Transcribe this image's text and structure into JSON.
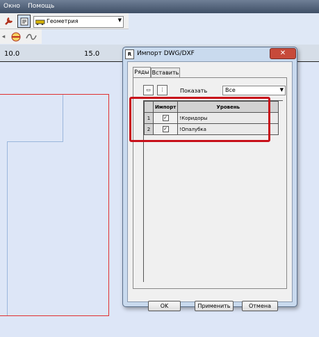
{
  "menu": {
    "items": [
      "Окно",
      "Помощь"
    ]
  },
  "toolbar": {
    "combo_value": "Геометрия"
  },
  "ruler": {
    "labels": [
      "10.0",
      "15.0"
    ]
  },
  "dialog": {
    "title": "Импорт DWG/DXF",
    "title_icon_letter": "R",
    "close_symbol": "✕",
    "tabs": [
      "Ряды",
      "Вставить"
    ],
    "show_label": "Показать",
    "show_value": "Все",
    "table": {
      "headers": [
        "Импорт",
        "Уровень"
      ],
      "rows": [
        {
          "num": "1",
          "checked": true,
          "level": "!Коридоры"
        },
        {
          "num": "2",
          "checked": true,
          "level": "!Опалубка"
        }
      ]
    },
    "buttons": {
      "ok": "OK",
      "apply": "Применить",
      "cancel": "Отмена"
    }
  },
  "colors": {
    "highlight": "#c8101a",
    "drawing_red": "#e03030",
    "drawing_blue": "#9ab6dc"
  }
}
